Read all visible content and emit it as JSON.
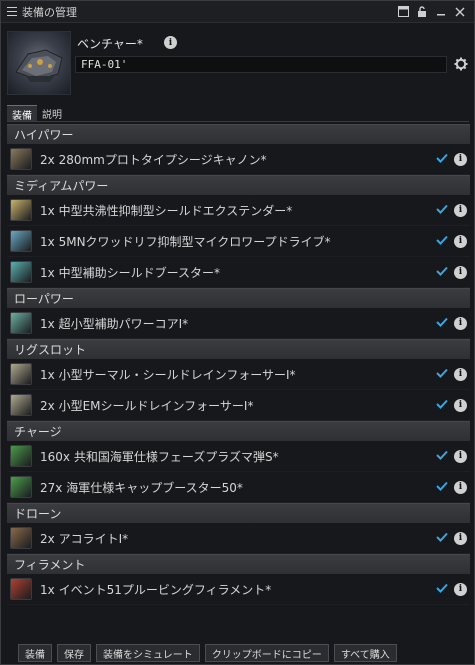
{
  "window": {
    "title": "装備の管理"
  },
  "ship": {
    "name": "ベンチャー*",
    "fit_name": "FFA-01'"
  },
  "tabs": [
    {
      "label": "装備"
    },
    {
      "label": "説明"
    }
  ],
  "sections": [
    {
      "title": "ハイパワー",
      "items": [
        {
          "qty": "2x",
          "name": "280mmプロトタイプシージキャノン*",
          "icon": "projectile-gun-icon",
          "color": "#8a7a5a"
        }
      ]
    },
    {
      "title": "ミディアムパワー",
      "items": [
        {
          "qty": "1x",
          "name": "中型共沸性抑制型シールドエクステンダー*",
          "icon": "shield-extender-icon",
          "color": "#c9b26a"
        },
        {
          "qty": "1x",
          "name": "5MNクワッドリフ抑制型マイクロワープドライブ*",
          "icon": "microwarpdrive-icon",
          "color": "#6aa8c0"
        },
        {
          "qty": "1x",
          "name": "中型補助シールドブースター*",
          "icon": "shield-booster-icon",
          "color": "#5ab0b0"
        }
      ]
    },
    {
      "title": "ローパワー",
      "items": [
        {
          "qty": "1x",
          "name": "超小型補助パワーコアI*",
          "icon": "power-core-icon",
          "color": "#6ab0a0"
        }
      ]
    },
    {
      "title": "リグスロット",
      "items": [
        {
          "qty": "1x",
          "name": "小型サーマル・シールドレインフォーサーI*",
          "icon": "rig-icon",
          "color": "#b0a890"
        },
        {
          "qty": "2x",
          "name": "小型EMシールドレインフォーサーI*",
          "icon": "rig-icon",
          "color": "#b0a890"
        }
      ]
    },
    {
      "title": "チャージ",
      "items": [
        {
          "qty": "160x",
          "name": "共和国海軍仕様フェーズプラズマ弾S*",
          "icon": "ammo-icon",
          "color": "#4a9a4a"
        },
        {
          "qty": "27x",
          "name": "海軍仕様キャップブースター50*",
          "icon": "cap-booster-icon",
          "color": "#4aa04a"
        }
      ]
    },
    {
      "title": "ドローン",
      "items": [
        {
          "qty": "2x",
          "name": "アコライトI*",
          "icon": "drone-icon",
          "color": "#8a6a4a"
        }
      ]
    },
    {
      "title": "フィラメント",
      "items": [
        {
          "qty": "1x",
          "name": "イベント51プルービングフィラメント*",
          "icon": "filament-icon",
          "color": "#b04030"
        }
      ]
    }
  ],
  "footer": {
    "buttons": [
      {
        "label": "装備",
        "name": "fit-button"
      },
      {
        "label": "保存",
        "name": "save-button"
      },
      {
        "label": "装備をシミュレート",
        "name": "simulate-button"
      },
      {
        "label": "クリップボードにコピー",
        "name": "copy-clipboard-button"
      },
      {
        "label": "すべて購入",
        "name": "buy-all-button"
      }
    ]
  }
}
